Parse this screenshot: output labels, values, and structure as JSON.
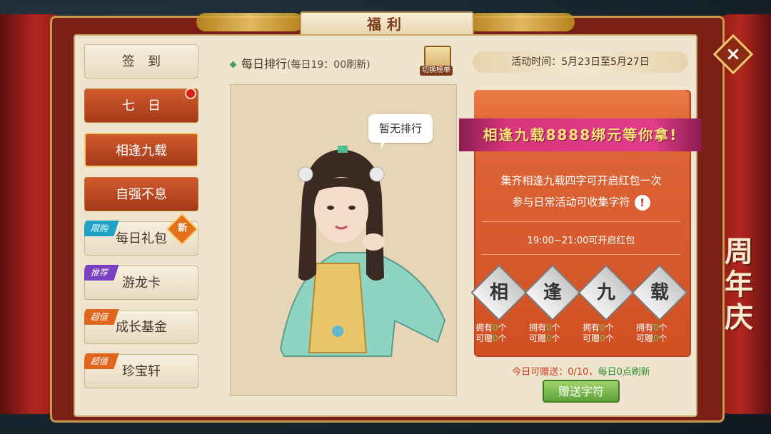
{
  "title": "福利",
  "close_icon": "×",
  "sidebar": {
    "tabs": [
      {
        "label": "签　到",
        "style": "plain",
        "ribbon": "",
        "dot": false,
        "new": false
      },
      {
        "label": "七　日",
        "style": "orange",
        "ribbon": "",
        "dot": true,
        "new": false
      },
      {
        "label": "相逢九载",
        "style": "active",
        "ribbon": "",
        "dot": false,
        "new": false
      },
      {
        "label": "自强不息",
        "style": "orange",
        "ribbon": "",
        "dot": false,
        "new": false
      },
      {
        "label": "每日礼包",
        "style": "plain",
        "ribbon": "限购",
        "ribbon_color": "#1fa3c4",
        "dot": false,
        "new": true
      },
      {
        "label": "游龙卡",
        "style": "plain",
        "ribbon": "推荐",
        "ribbon_color": "#7b3fc4",
        "dot": false,
        "new": false
      },
      {
        "label": "成长基金",
        "style": "plain",
        "ribbon": "超值",
        "ribbon_color": "#e0661d",
        "dot": false,
        "new": false
      },
      {
        "label": "珍宝轩",
        "style": "plain",
        "ribbon": "超值",
        "ribbon_color": "#e0661d",
        "dot": false,
        "new": false
      }
    ],
    "new_badge": "新"
  },
  "rank": {
    "header": "每日排行",
    "refresh": "(每日19：00刷新)",
    "switch_label": "切换榜单",
    "empty_text": "暂无排行"
  },
  "event_time": "活动时间：5月23日至5月27日",
  "envelope": {
    "banner": "相逢九载8888绑元等你拿!",
    "desc_line1": "集齐相逢九载四字可开启红包一次",
    "desc_line2": "参与日常活动可收集字符",
    "info_icon": "!",
    "open_time": "19:00~21:00可开启红包",
    "chars": [
      {
        "char": "相",
        "own_label": "拥有",
        "own": "0",
        "gift_label": "可赠",
        "gift": "0",
        "unit": "个"
      },
      {
        "char": "逢",
        "own_label": "拥有",
        "own": "0",
        "gift_label": "可赠",
        "gift": "0",
        "unit": "个"
      },
      {
        "char": "九",
        "own_label": "拥有",
        "own": "0",
        "gift_label": "可赠",
        "gift": "0",
        "unit": "个"
      },
      {
        "char": "载",
        "own_label": "拥有",
        "own": "0",
        "gift_label": "可赠",
        "gift": "0",
        "unit": "个"
      }
    ]
  },
  "gift_info": {
    "prefix": "今日可赠送：0/10，",
    "suffix": "每日0点刷新"
  },
  "gift_button": "赠送字符",
  "side_decor": "周年庆"
}
